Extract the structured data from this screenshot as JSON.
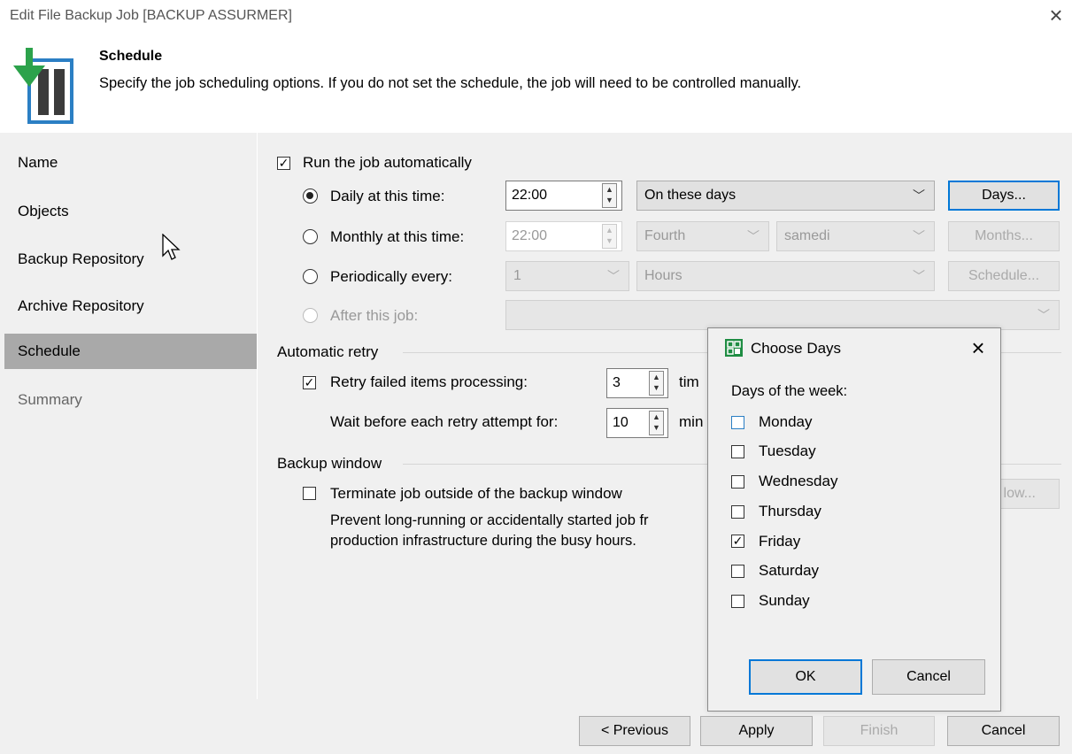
{
  "window": {
    "title": "Edit File Backup Job [BACKUP ASSURMER]"
  },
  "header": {
    "title": "Schedule",
    "description": "Specify the job scheduling options. If you do not set the schedule, the job will need to be controlled manually."
  },
  "nav": {
    "items": [
      {
        "label": "Name"
      },
      {
        "label": "Objects"
      },
      {
        "label": "Backup Repository"
      },
      {
        "label": "Archive Repository"
      },
      {
        "label": "Schedule"
      },
      {
        "label": "Summary"
      }
    ],
    "selected": "Schedule"
  },
  "schedule": {
    "run_auto_label": "Run the job automatically",
    "run_auto_checked": true,
    "daily": {
      "label": "Daily at this time:",
      "time": "22:00",
      "mode": "On these days",
      "button": "Days...",
      "selected": true
    },
    "monthly": {
      "label": "Monthly at this time:",
      "time": "22:00",
      "week": "Fourth",
      "day": "samedi",
      "button": "Months..."
    },
    "periodic": {
      "label": "Periodically every:",
      "value": "1",
      "unit": "Hours",
      "button": "Schedule..."
    },
    "after": {
      "label": "After this job:",
      "value": ""
    }
  },
  "retry": {
    "section": "Automatic retry",
    "label": "Retry failed items processing:",
    "checked": true,
    "count": "3",
    "count_unit": "tim",
    "wait_label": "Wait before each retry attempt for:",
    "wait": "10",
    "wait_unit": "min"
  },
  "window_section": {
    "section": "Backup window",
    "terminate_label": "Terminate job outside of the backup window",
    "terminate_checked": false,
    "desc1": "Prevent long-running or accidentally started job fr",
    "desc2": "production infrastructure during the busy hours.",
    "button": "low..."
  },
  "footer": {
    "previous": "< Previous",
    "apply": "Apply",
    "finish": "Finish",
    "cancel": "Cancel"
  },
  "dialog": {
    "title": "Choose Days",
    "days_label": "Days of the week:",
    "days": [
      {
        "label": "Monday",
        "checked": false
      },
      {
        "label": "Tuesday",
        "checked": false
      },
      {
        "label": "Wednesday",
        "checked": false
      },
      {
        "label": "Thursday",
        "checked": false
      },
      {
        "label": "Friday",
        "checked": true
      },
      {
        "label": "Saturday",
        "checked": false
      },
      {
        "label": "Sunday",
        "checked": false
      }
    ],
    "ok": "OK",
    "cancel": "Cancel"
  },
  "colors": {
    "accent": "#0078d7",
    "veeam_green": "#1f8d43",
    "selected_nav": "#a9a9a9"
  }
}
